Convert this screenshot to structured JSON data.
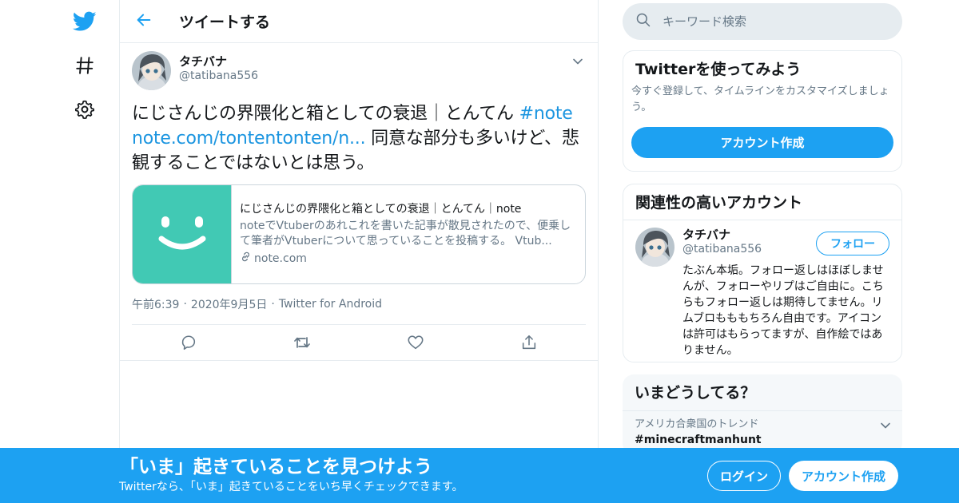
{
  "colors": {
    "accent": "#1da1f2",
    "link": "#1b95e0",
    "secondary_text": "#657786",
    "card_thumb": "#41c9b4"
  },
  "rail": {
    "icons": [
      "twitter-logo-icon",
      "hashtag-icon",
      "gear-icon"
    ]
  },
  "header": {
    "title": "ツイートする"
  },
  "tweet": {
    "display_name": "タチバナ",
    "handle": "@tatibana556",
    "text_before": "にじさんじの界隈化と箱としての衰退｜とんてん ",
    "hashtag": "#note",
    "link": "note.com/tontentonten/n...",
    "text_after": " 同意な部分も多いけど、悲観することではないとは思う。",
    "card": {
      "title": "にじさんじの界隈化と箱としての衰退｜とんてん｜note",
      "description": "noteでVtuberのあれこれを書いた記事が散見されたので、便乗して筆者がVtuberについて思っていることを投稿する。 Vtub...",
      "domain": "note.com"
    },
    "time": "午前6:39",
    "date": "2020年9月5日",
    "client": "Twitter for Android"
  },
  "search": {
    "placeholder": "キーワード検索"
  },
  "try_twitter": {
    "title": "Twitterを使ってみよう",
    "description": "今すぐ登録して、タイムラインをカスタマイズしましょう。",
    "button": "アカウント作成"
  },
  "related": {
    "title": "関連性の高いアカウント",
    "account": {
      "name": "タチバナ",
      "handle": "@tatibana556",
      "follow": "フォロー",
      "bio": "たぶん本垢。フォロー返しはほぼしませんが、フォローやリプはご自由に。こちらもフォロー返しは期待してません。リムブロもももちろん自由です。アイコンは許可はもらってますが、自作絵ではありません。"
    }
  },
  "trends": {
    "title": "いまどうしてる？",
    "items": [
      {
        "context": "アメリカ合衆国のトレンド",
        "name": "#minecraftmanhunt"
      }
    ]
  },
  "bottom_bar": {
    "title": "「いま」起きていることを見つけよう",
    "subtitle": "Twitterなら、「いま」起きていることをいち早くチェックできます。",
    "login": "ログイン",
    "signup": "アカウント作成"
  }
}
